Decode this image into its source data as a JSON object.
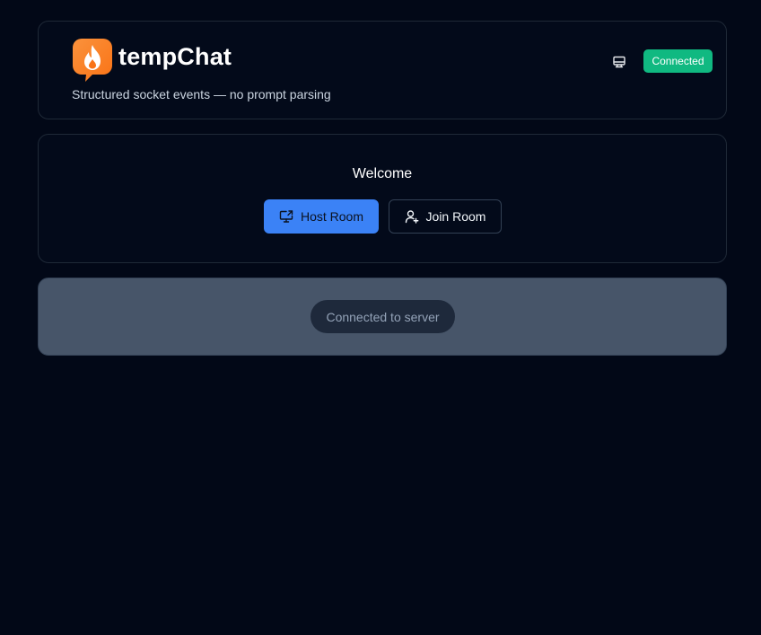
{
  "header": {
    "app_title": "tempChat",
    "subtitle": "Structured socket events — no prompt parsing",
    "status_badge": "Connected",
    "logo_icon": "flame-chat-logo-icon",
    "monitor_icon": "monitor-icon"
  },
  "welcome": {
    "title": "Welcome",
    "host_button": {
      "label": "Host Room",
      "icon": "screen-share-icon"
    },
    "join_button": {
      "label": "Join Room",
      "icon": "user-plus-icon"
    }
  },
  "status": {
    "message": "Connected to server"
  },
  "colors": {
    "background": "#020817",
    "accent": "#3b82f6",
    "connected": "#10b981",
    "logo": "#f97316"
  }
}
